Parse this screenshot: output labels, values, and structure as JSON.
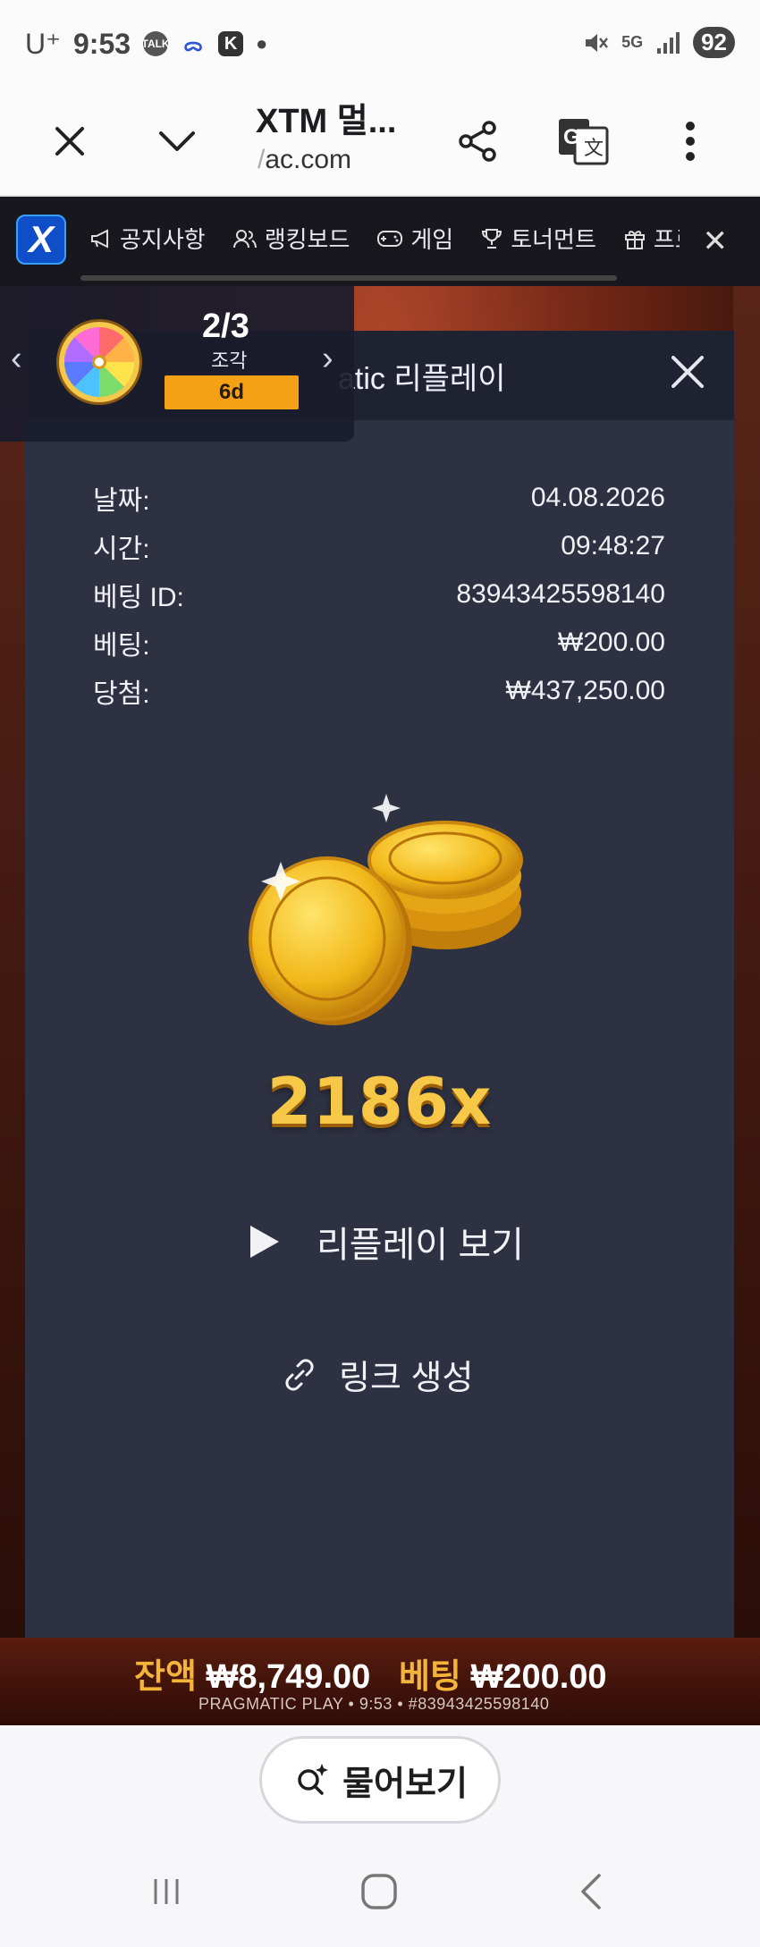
{
  "status_bar": {
    "carrier": "U⁺",
    "time": "9:53",
    "icons": [
      "talk-icon",
      "notification-icon",
      "k-app-icon",
      "dot-icon"
    ],
    "right_icons": [
      "mute-icon",
      "5g-icon",
      "signal-icon"
    ],
    "network": "5G",
    "battery": "92"
  },
  "browser": {
    "title": "XTM 멀...",
    "url_prefix": "/",
    "url_main": "ac.com"
  },
  "site_nav": {
    "logo": "X",
    "items": [
      {
        "label": "공지사항",
        "icon": "megaphone-icon"
      },
      {
        "label": "랭킹보드",
        "icon": "users-icon"
      },
      {
        "label": "게임",
        "icon": "gamepad-icon"
      },
      {
        "label": "토너먼트",
        "icon": "trophy-icon"
      },
      {
        "label": "프로",
        "icon": "gift-icon"
      }
    ]
  },
  "wheel_widget": {
    "count": "2/3",
    "label": "조각",
    "badge": "6d"
  },
  "replay": {
    "title_visible": "atic 리플레이",
    "rows": [
      {
        "label": "날짜:",
        "value": "04.08.2026"
      },
      {
        "label": "시간:",
        "value": "09:48:27"
      },
      {
        "label": "베팅 ID:",
        "value": "83943425598140"
      },
      {
        "label": "베팅:",
        "value": "₩200.00"
      },
      {
        "label": "당첨:",
        "value": "₩437,250.00"
      }
    ],
    "multiplier": "2186x",
    "replay_button": "리플레이 보기",
    "link_button": "링크 생성"
  },
  "game_footer": {
    "balance_label": "잔액",
    "balance_value": "₩8,749.00",
    "bet_label": "베팅",
    "bet_value": "₩200.00",
    "sub": "PRAGMATIC PLAY • 9:53 • #83943425598140"
  },
  "ask_button": "물어보기",
  "colors": {
    "accent_gold": "#f7c847",
    "badge_orange": "#f5a116",
    "panel_bg": "#2e3142",
    "nav_bg": "#17171d"
  }
}
